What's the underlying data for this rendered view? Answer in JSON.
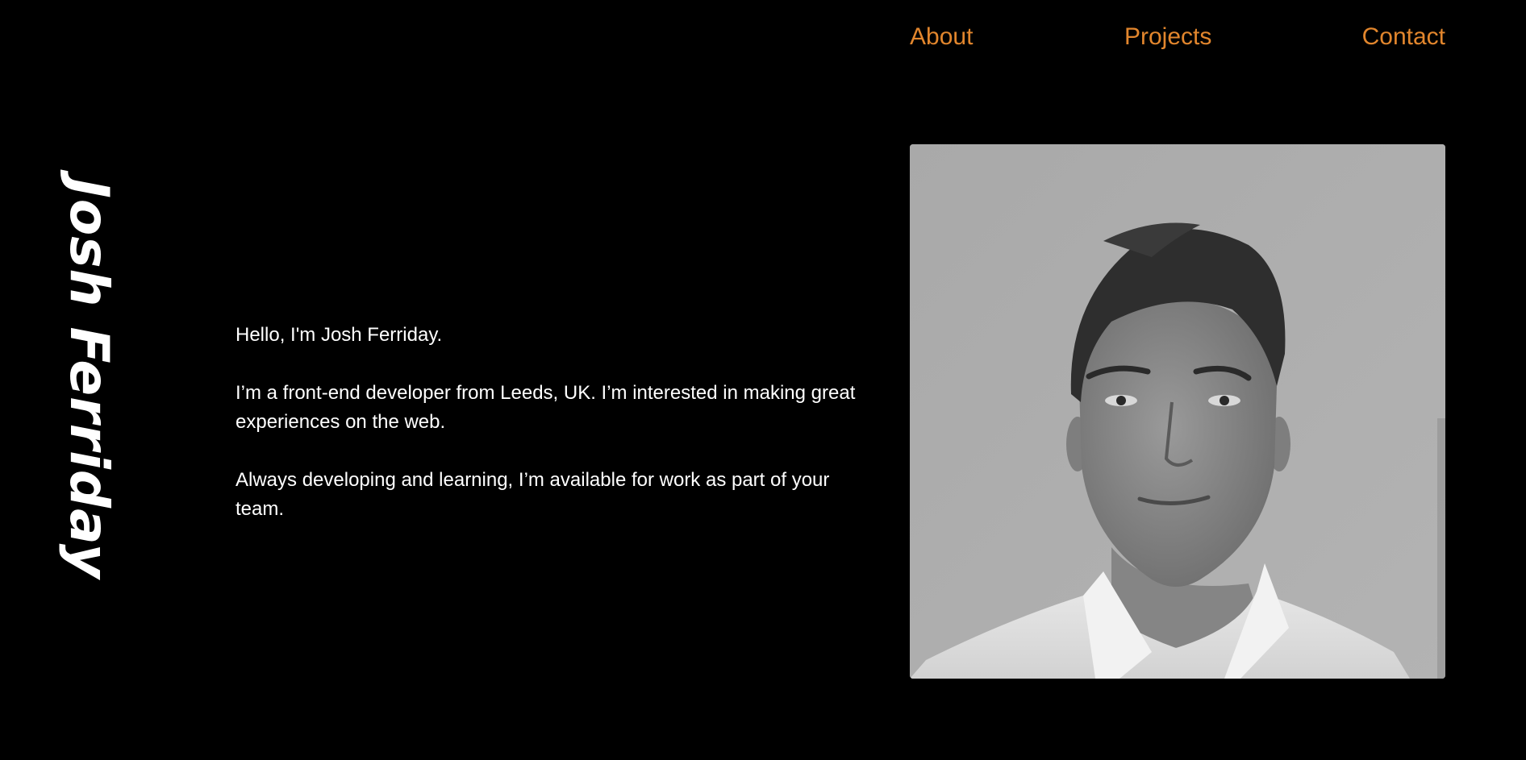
{
  "nav": {
    "items": [
      {
        "label": "About"
      },
      {
        "label": "Projects"
      },
      {
        "label": "Contact"
      }
    ]
  },
  "sidebar": {
    "name": "Josh Ferriday"
  },
  "intro": {
    "paragraphs": [
      "Hello, I'm Josh Ferriday.",
      "I’m a front-end developer from Leeds, UK. I’m interested in making great experiences on the web.",
      "Always developing and learning, I’m available for work as part of your team."
    ]
  },
  "colors": {
    "background": "#000000",
    "accent": "#e2862d",
    "text": "#ffffff"
  }
}
